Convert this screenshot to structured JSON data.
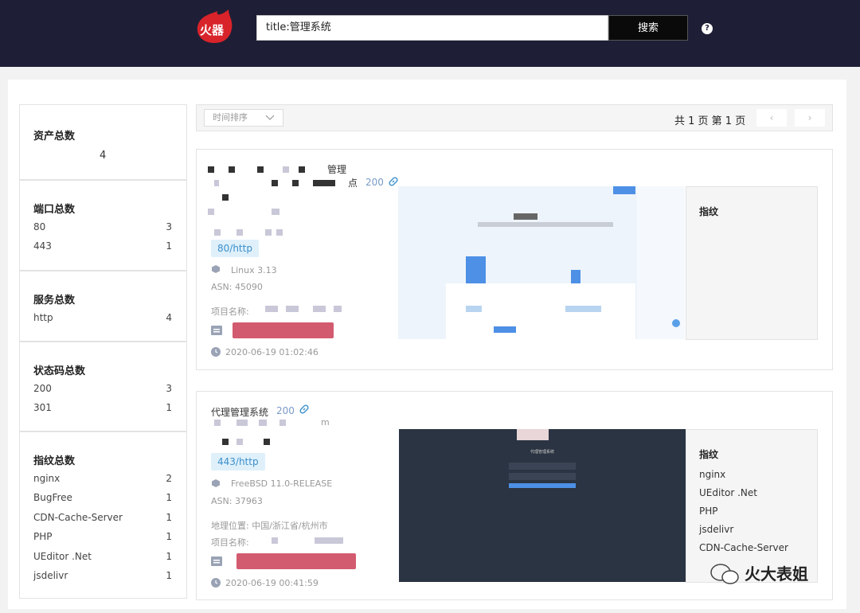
{
  "header": {
    "search_value": "title:管理系统",
    "search_button": "搜索",
    "help": "?"
  },
  "stats": {
    "assets": {
      "title": "资产总数",
      "value": "4"
    },
    "ports": {
      "title": "端口总数",
      "rows": [
        {
          "k": "80",
          "v": "3"
        },
        {
          "k": "443",
          "v": "1"
        }
      ]
    },
    "services": {
      "title": "服务总数",
      "rows": [
        {
          "k": "http",
          "v": "4"
        }
      ]
    },
    "status_codes": {
      "title": "状态码总数",
      "rows": [
        {
          "k": "200",
          "v": "3"
        },
        {
          "k": "301",
          "v": "1"
        }
      ]
    },
    "fingerprints": {
      "title": "指纹总数",
      "rows": [
        {
          "k": "nginx",
          "v": "2"
        },
        {
          "k": "BugFree",
          "v": "1"
        },
        {
          "k": "CDN-Cache-Server",
          "v": "1"
        },
        {
          "k": "PHP",
          "v": "1"
        },
        {
          "k": "UEditor .Net",
          "v": "1"
        },
        {
          "k": "jsdelivr",
          "v": "1"
        }
      ]
    }
  },
  "toolbar": {
    "sort_label": "时间排序",
    "pager_text": "共 1 页  第 1 页",
    "prev": "‹",
    "next": "›"
  },
  "results": [
    {
      "title_tail": "管理",
      "title_tail2": "点",
      "status": "200",
      "port_tag": "80/http",
      "os": "Linux 3.13",
      "asn": "ASN: 45090",
      "project_label": "项目名称:",
      "time": "2020-06-19 01:02:46",
      "fp_title": "指纹",
      "fingerprints": []
    },
    {
      "title": "代理管理系统",
      "status": "200",
      "blur_tail": "m",
      "port_tag": "443/http",
      "os": "FreeBSD 11.0-RELEASE",
      "asn": "ASN: 37963",
      "location": "地理位置: 中国/浙江省/杭州市",
      "project_label": "项目名称:",
      "time": "2020-06-19 00:41:59",
      "fp_title": "指纹",
      "fingerprints": [
        "nginx",
        "UEditor .Net",
        "PHP",
        "jsdelivr",
        "CDN-Cache-Server"
      ],
      "shot_title": "代理管理系统"
    }
  ],
  "watermark": "火大表姐",
  "colors": {
    "topbar": "#1e1f36",
    "accent": "#3b8fcb",
    "redact": "#d35b6f"
  }
}
